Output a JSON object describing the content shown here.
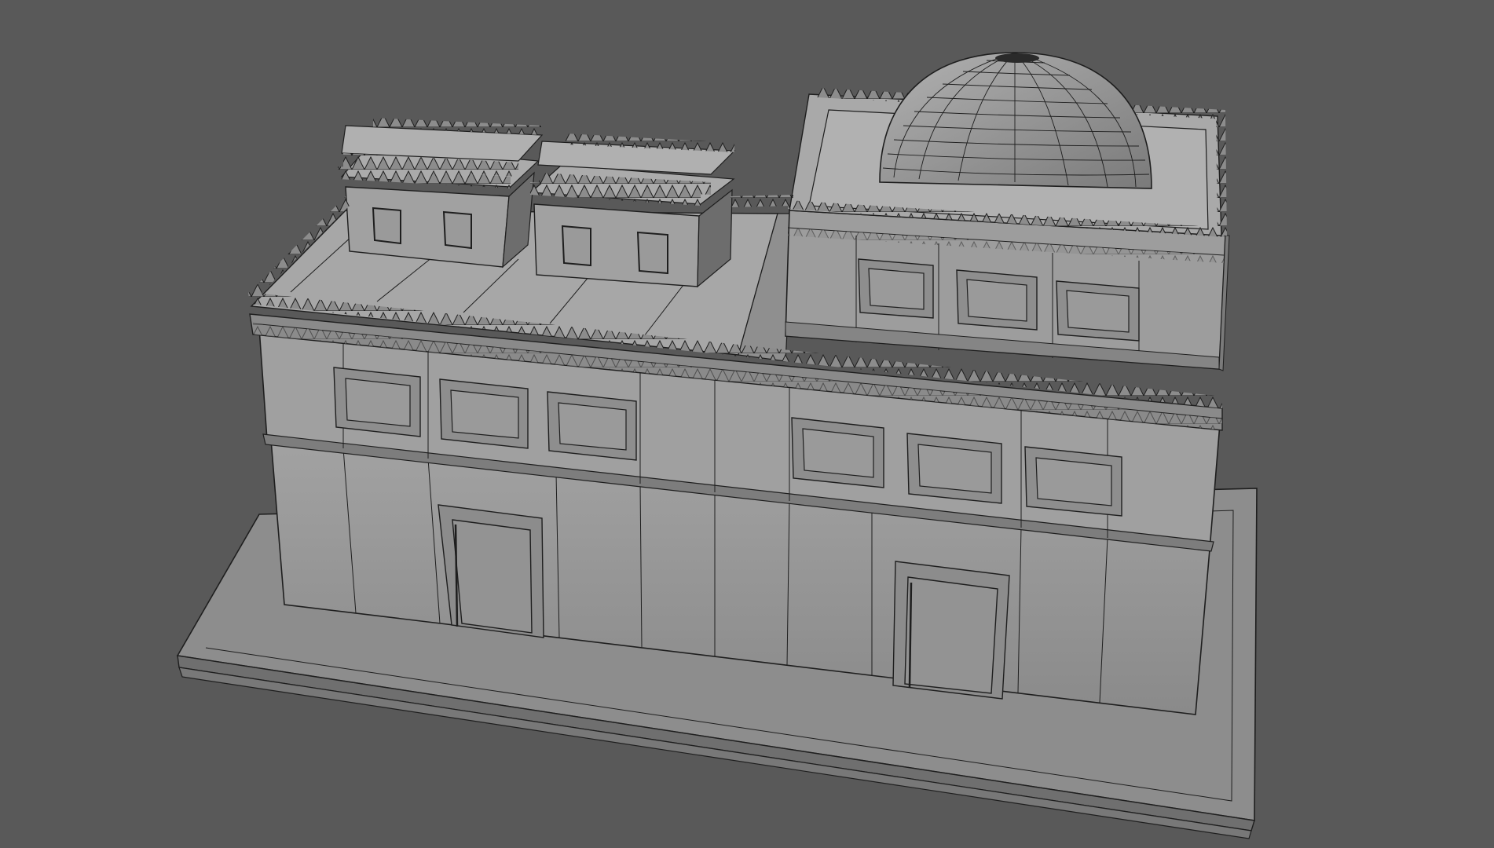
{
  "viewport": {
    "background": "#595959",
    "shade_colors": {
      "lit": "#9a9a9a",
      "mid": "#8a8a8a",
      "dark": "#6e6e6e",
      "edge": "#1e1e1e"
    }
  },
  "scene": {
    "object": "building-model",
    "render_mode": "shaded-with-wireframe",
    "parts": [
      "base-platform",
      "front-wall",
      "roof",
      "crenellations",
      "rooftop-pavilion-left",
      "rooftop-pavilion-right",
      "tower-block",
      "dome"
    ]
  }
}
